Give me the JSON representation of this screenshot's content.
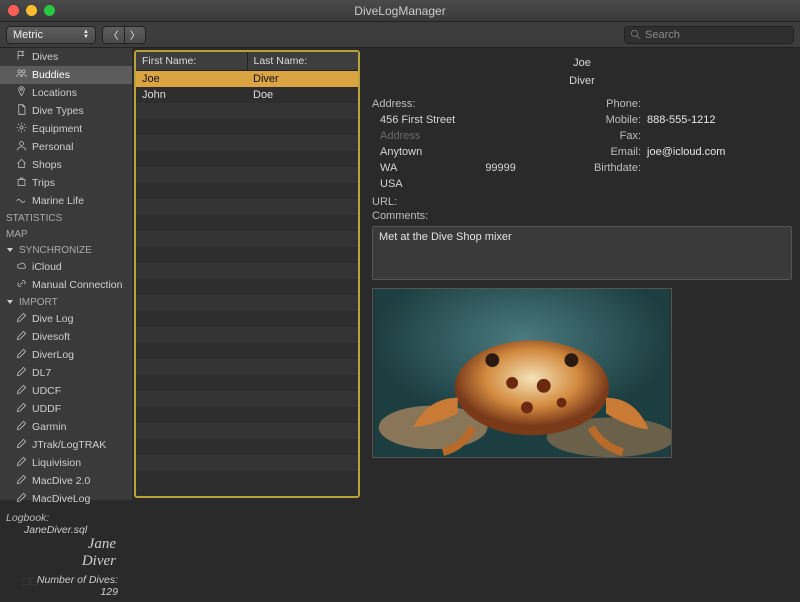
{
  "window": {
    "title": "DiveLogManager"
  },
  "toolbar": {
    "unit_label": "Metric",
    "search_placeholder": "Search"
  },
  "sidebar": {
    "sections": [
      {
        "kind": "item",
        "icon": "flag",
        "label": "Dives"
      },
      {
        "kind": "item",
        "icon": "people",
        "label": "Buddies",
        "selected": true
      },
      {
        "kind": "item",
        "icon": "pin",
        "label": "Locations"
      },
      {
        "kind": "item",
        "icon": "doc",
        "label": "Dive Types"
      },
      {
        "kind": "item",
        "icon": "gear",
        "label": "Equipment"
      },
      {
        "kind": "item",
        "icon": "person",
        "label": "Personal"
      },
      {
        "kind": "item",
        "icon": "home",
        "label": "Shops"
      },
      {
        "kind": "item",
        "icon": "bag",
        "label": "Trips"
      },
      {
        "kind": "item",
        "icon": "wave",
        "label": "Marine Life"
      },
      {
        "kind": "hdr",
        "label": "STATISTICS"
      },
      {
        "kind": "hdr",
        "label": "MAP"
      },
      {
        "kind": "hdr",
        "label": "SYNCHRONIZE",
        "disclosure": "open"
      },
      {
        "kind": "item",
        "icon": "cloud",
        "label": "iCloud"
      },
      {
        "kind": "item",
        "icon": "link",
        "label": "Manual Connection",
        "dot": true
      },
      {
        "kind": "hdr",
        "label": "IMPORT",
        "disclosure": "open"
      },
      {
        "kind": "item",
        "icon": "pencil",
        "label": "Dive Log"
      },
      {
        "kind": "item",
        "icon": "pencil",
        "label": "Divesoft"
      },
      {
        "kind": "item",
        "icon": "pencil",
        "label": "DiverLog"
      },
      {
        "kind": "item",
        "icon": "pencil",
        "label": "DL7"
      },
      {
        "kind": "item",
        "icon": "pencil",
        "label": "UDCF"
      },
      {
        "kind": "item",
        "icon": "pencil",
        "label": "UDDF"
      },
      {
        "kind": "item",
        "icon": "pencil",
        "label": "Garmin"
      },
      {
        "kind": "item",
        "icon": "pencil",
        "label": "JTrak/LogTRAK"
      },
      {
        "kind": "item",
        "icon": "pencil",
        "label": "Liquivision"
      },
      {
        "kind": "item",
        "icon": "pencil",
        "label": "MacDive 2.0"
      },
      {
        "kind": "item",
        "icon": "pencil",
        "label": "MacDiveLog"
      }
    ],
    "logbook_label": "Logbook:",
    "logbook_file": "JaneDiver.sql",
    "owner_first": "Jane",
    "owner_last": "Diver",
    "ndives_label": "Number of Dives:",
    "ndives": "129"
  },
  "list": {
    "columns": {
      "first": "First Name:",
      "last": "Last Name:"
    },
    "rows": [
      {
        "first": "Joe",
        "last": "Diver",
        "selected": true
      },
      {
        "first": "John",
        "last": "Doe"
      }
    ],
    "blank_rows": 24
  },
  "detail": {
    "first": "Joe",
    "last": "Diver",
    "address_label": "Address:",
    "street": "456 First Street",
    "street2_ph": "Address",
    "city": "Anytown",
    "state": "WA",
    "zip": "99999",
    "country": "USA",
    "phone_label": "Phone:",
    "phone": "",
    "mobile_label": "Mobile:",
    "mobile": "888-555-1212",
    "fax_label": "Fax:",
    "fax": "",
    "email_label": "Email:",
    "email": "joe@icloud.com",
    "birth_label": "Birthdate:",
    "birth": "",
    "url_label": "URL:",
    "url": "",
    "comments_label": "Comments:",
    "comments": "Met at the Dive Shop mixer"
  }
}
